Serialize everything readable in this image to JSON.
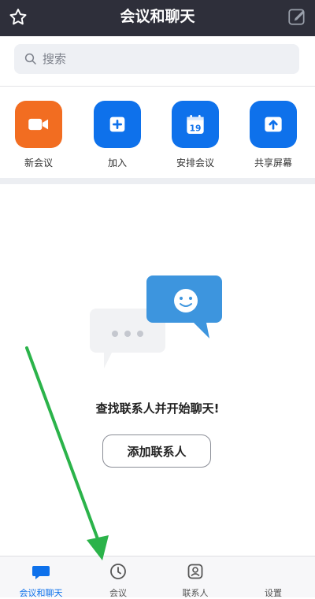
{
  "header": {
    "title": "会议和聊天",
    "left_icon": "star-icon",
    "right_icon": "compose-icon"
  },
  "search": {
    "placeholder": "搜索",
    "icon": "search-icon"
  },
  "actions": [
    {
      "label": "新会议",
      "icon": "video-camera-icon",
      "color": "#f26d21"
    },
    {
      "label": "加入",
      "icon": "plus-icon",
      "color": "#0e71eb"
    },
    {
      "label": "安排会议",
      "icon": "calendar-icon",
      "color": "#0e71eb",
      "icon_text": "19"
    },
    {
      "label": "共享屏幕",
      "icon": "share-screen-icon",
      "color": "#0e71eb"
    }
  ],
  "empty_state": {
    "title": "查找联系人并开始聊天!",
    "button_label": "添加联系人"
  },
  "bottom_nav": [
    {
      "label": "会议和聊天",
      "icon": "chat-icon",
      "active": true
    },
    {
      "label": "会议",
      "icon": "clock-icon",
      "active": false
    },
    {
      "label": "联系人",
      "icon": "contact-icon",
      "active": false
    },
    {
      "label": "设置",
      "icon": "settings-icon",
      "active": false
    }
  ],
  "colors": {
    "accent": "#0e71eb",
    "header_bg": "#2e2f3a",
    "new_meeting": "#f26d21",
    "annotation_arrow": "#2bb34a"
  }
}
